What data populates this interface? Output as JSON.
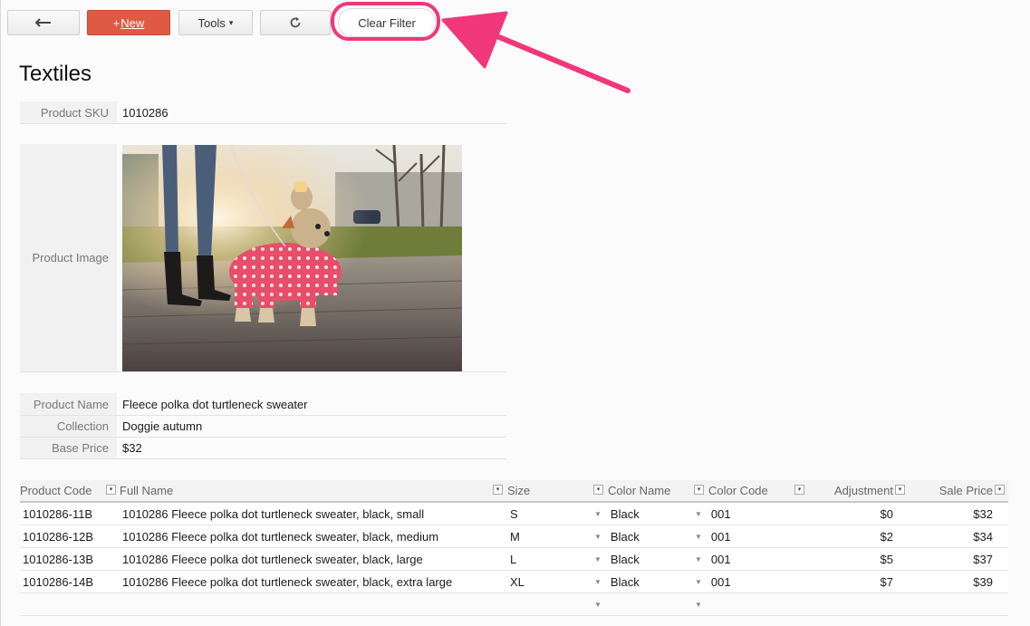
{
  "toolbar": {
    "back_icon": "arrow-left-icon",
    "new_plus": "+",
    "new_label": "New",
    "tools_label": "Tools",
    "tools_caret": "▾",
    "refresh_icon": "refresh-icon",
    "clear_filter_label": "Clear Filter",
    "accent_color": "#e05a43",
    "highlight_color": "#f0377a"
  },
  "page": {
    "title": "Textiles"
  },
  "fields": {
    "sku_label": "Product SKU",
    "sku_value": "1010286",
    "image_label": "Product Image",
    "name_label": "Product Name",
    "name_value": "Fleece polka dot turtleneck sweater",
    "collection_label": "Collection",
    "collection_value": "Doggie autumn",
    "base_price_label": "Base Price",
    "base_price_value": "$32"
  },
  "grid": {
    "headers": {
      "product_code": "Product Code",
      "full_name": "Full Name",
      "size": "Size",
      "color_name": "Color Name",
      "color_code": "Color Code",
      "adjustment": "Adjustment",
      "sale_price": "Sale Price"
    },
    "dropdown_glyph": "▼",
    "rows": [
      {
        "code": "1010286-11B",
        "name": "1010286 Fleece polka dot turtleneck sweater, black, small",
        "size": "S",
        "color": "Black",
        "color_code": "001",
        "adjustment": "$0",
        "sale_price": "$32"
      },
      {
        "code": "1010286-12B",
        "name": "1010286 Fleece polka dot turtleneck sweater, black, medium",
        "size": "M",
        "color": "Black",
        "color_code": "001",
        "adjustment": "$2",
        "sale_price": "$34"
      },
      {
        "code": "1010286-13B",
        "name": "1010286 Fleece polka dot turtleneck sweater, black, large",
        "size": "L",
        "color": "Black",
        "color_code": "001",
        "adjustment": "$5",
        "sale_price": "$37"
      },
      {
        "code": "1010286-14B",
        "name": "1010286 Fleece polka dot turtleneck sweater, black, extra large",
        "size": "XL",
        "color": "Black",
        "color_code": "001",
        "adjustment": "$7",
        "sale_price": "$39"
      }
    ]
  }
}
